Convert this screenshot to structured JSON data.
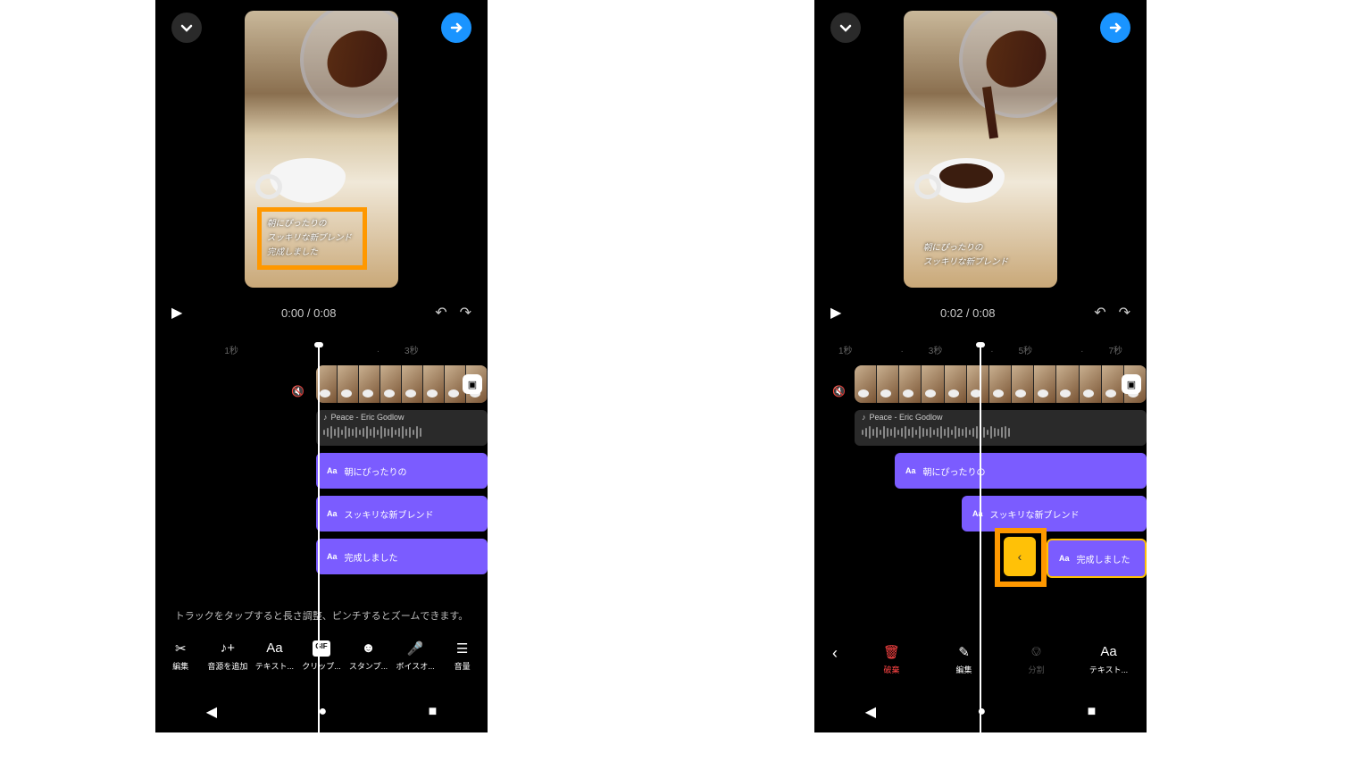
{
  "left": {
    "time": "0:00 / 0:08",
    "ruler": [
      "",
      "1秒",
      "",
      "3秒"
    ],
    "music": "Peace - Eric Godlow",
    "captions": [
      "朝にぴったりの",
      "スッキリな新ブレンド",
      "完成しました"
    ],
    "preview_lines": [
      "朝にぴったりの",
      "スッキリな新ブレンド",
      "完成しました"
    ],
    "help": "トラックをタップすると長さ調整、ピンチするとズームできます。",
    "tools": [
      {
        "icon": "✂",
        "label": "編集"
      },
      {
        "icon": "♪",
        "label": "音源を追加"
      },
      {
        "icon": "Aa",
        "label": "テキスト..."
      },
      {
        "icon": "GIF",
        "label": "クリップ..."
      },
      {
        "icon": "☻",
        "label": "スタンプ..."
      },
      {
        "icon": "🎤",
        "label": "ボイスオ..."
      },
      {
        "icon": "⚙",
        "label": "音量"
      }
    ]
  },
  "right": {
    "time": "0:02 / 0:08",
    "ruler": [
      "",
      "1秒",
      "",
      "3秒",
      "",
      "5秒",
      "",
      "7秒"
    ],
    "music": "Peace - Eric Godlow",
    "captions": [
      "朝にぴったりの",
      "スッキリな新ブレンド",
      "完成しました"
    ],
    "preview_lines": [
      "朝にぴったりの",
      "スッキリな新ブレンド"
    ],
    "tools": [
      {
        "icon": "🗑",
        "label": "破棄",
        "cls": "red"
      },
      {
        "icon": "✎",
        "label": "編集"
      },
      {
        "icon": "⎊",
        "label": "分割",
        "cls": "dim"
      },
      {
        "icon": "Aa",
        "label": "テキスト..."
      }
    ]
  }
}
